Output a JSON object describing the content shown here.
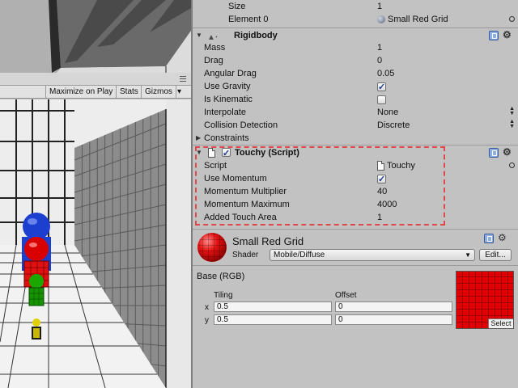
{
  "game_toolbar": {
    "maximize_label": "Maximize on Play",
    "stats_label": "Stats",
    "gizmos_label": "Gizmos",
    "gizmos_arrow": "▾"
  },
  "inspector": {
    "top_rows": {
      "size_label": "Size",
      "size_value": "1",
      "element_label": "Element 0",
      "element_value": "Small Red Grid"
    },
    "rigidbody": {
      "title": "Rigidbody",
      "mass_label": "Mass",
      "mass_value": "1",
      "drag_label": "Drag",
      "drag_value": "0",
      "angular_drag_label": "Angular Drag",
      "angular_drag_value": "0.05",
      "use_gravity_label": "Use Gravity",
      "use_gravity_checked": true,
      "is_kinematic_label": "Is Kinematic",
      "is_kinematic_checked": false,
      "interpolate_label": "Interpolate",
      "interpolate_value": "None",
      "collision_label": "Collision Detection",
      "collision_value": "Discrete",
      "constraints_label": "Constraints"
    },
    "touchy": {
      "title": "Touchy (Script)",
      "enabled": true,
      "script_label": "Script",
      "script_value": "Touchy",
      "use_momentum_label": "Use Momentum",
      "use_momentum_checked": true,
      "momentum_multiplier_label": "Momentum Multiplier",
      "momentum_multiplier_value": "40",
      "momentum_maximum_label": "Momentum Maximum",
      "momentum_maximum_value": "4000",
      "added_touch_area_label": "Added Touch Area",
      "added_touch_area_value": "1"
    },
    "material": {
      "name": "Small Red Grid",
      "shader_label": "Shader",
      "shader_value": "Mobile/Diffuse",
      "edit_label": "Edit...",
      "base_label": "Base (RGB)",
      "tiling_label": "Tiling",
      "offset_label": "Offset",
      "x_label": "x",
      "y_label": "y",
      "tiling_x": "0.5",
      "tiling_y": "0.5",
      "offset_x": "0",
      "offset_y": "0",
      "select_label": "Select",
      "texture_color": "#e00000"
    }
  },
  "colors": {
    "panel_bg": "#c2c2c2",
    "highlight": "#e0474b",
    "accent_blue": "#1d3a8a"
  }
}
